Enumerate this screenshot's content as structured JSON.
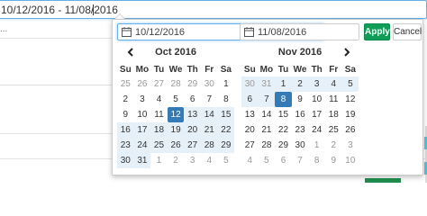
{
  "range_field": {
    "value_before_caret": "10/12/2016 - 11/08/",
    "value_after_caret": "2016"
  },
  "background": {
    "dots": "..."
  },
  "picker": {
    "start_date": "10/12/2016",
    "end_date": "11/08/2016",
    "apply_label": "Apply",
    "cancel_label": "Cancel",
    "weekday_labels": [
      "Su",
      "Mo",
      "Tu",
      "We",
      "Th",
      "Fr",
      "Sa"
    ],
    "calendars": [
      {
        "title": "Oct 2016",
        "weeks": [
          [
            "25",
            "26",
            "27",
            "28",
            "29",
            "30",
            "1"
          ],
          [
            "2",
            "3",
            "4",
            "5",
            "6",
            "7",
            "8"
          ],
          [
            "9",
            "10",
            "11",
            "12",
            "13",
            "14",
            "15"
          ],
          [
            "16",
            "17",
            "18",
            "19",
            "20",
            "21",
            "22"
          ],
          [
            "23",
            "24",
            "25",
            "26",
            "27",
            "28",
            "29"
          ],
          [
            "30",
            "31",
            "1",
            "2",
            "3",
            "4",
            "5"
          ]
        ]
      },
      {
        "title": "Nov 2016",
        "weeks": [
          [
            "30",
            "31",
            "1",
            "2",
            "3",
            "4",
            "5"
          ],
          [
            "6",
            "7",
            "8",
            "9",
            "10",
            "11",
            "12"
          ],
          [
            "13",
            "14",
            "15",
            "16",
            "17",
            "18",
            "19"
          ],
          [
            "20",
            "21",
            "22",
            "23",
            "24",
            "25",
            "26"
          ],
          [
            "27",
            "28",
            "29",
            "30",
            "1",
            "2",
            "3"
          ],
          [
            "4",
            "5",
            "6",
            "7",
            "8",
            "9",
            "10"
          ]
        ]
      }
    ]
  },
  "icons": {
    "calendar": "calendar-icon",
    "prev": "chevron-left-icon",
    "next": "chevron-right-icon"
  },
  "colors": {
    "accent": "#337ab7",
    "range_fill": "#e6f0f8",
    "apply_green": "#0f9d58",
    "off_day": "#999999"
  }
}
